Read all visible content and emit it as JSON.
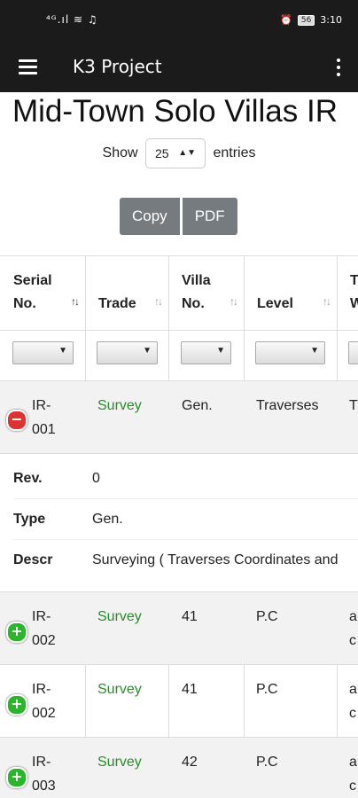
{
  "statusbar": {
    "signal": "⁴ᴳ.ıl ≋ ♫",
    "alarm": "⏰",
    "battery": "56",
    "time": "3:10"
  },
  "appbar": {
    "title": "K3 Project"
  },
  "page": {
    "title": "Mid-Town Solo Villas IR"
  },
  "length_menu": {
    "show_label": "Show",
    "selected": "25",
    "entries_label": "entries"
  },
  "buttons": {
    "copy": "Copy",
    "pdf": "PDF"
  },
  "columns": {
    "serial": {
      "line1": "Serial",
      "line2": "No."
    },
    "trade": "Trade",
    "villa": {
      "line1": "Villa",
      "line2": "No."
    },
    "level": "Level",
    "type_partial": {
      "line1": "T",
      "line2": "W"
    }
  },
  "rows": [
    {
      "serial1": "IR-",
      "serial2": "001",
      "trade": "Survey",
      "villa": "Gen.",
      "level": "Traverses",
      "extra1": "T",
      "extra2": ""
    },
    {
      "serial1": "IR-",
      "serial2": "002",
      "trade": "Survey",
      "villa": "41",
      "level": "P.C",
      "extra1": "a",
      "extra2": "c"
    },
    {
      "serial1": "IR-",
      "serial2": "002",
      "trade": "Survey",
      "villa": "41",
      "level": "P.C",
      "extra1": "a",
      "extra2": "c"
    },
    {
      "serial1": "IR-",
      "serial2": "003",
      "trade": "Survey",
      "villa": "42",
      "level": "P.C",
      "extra1": "a",
      "extra2": "c"
    }
  ],
  "detail": {
    "rev_label": "Rev.",
    "rev_value": "0",
    "type_label": "Type",
    "type_value": "Gen.",
    "descr_label": "Descr",
    "descr_value": "Surveying ( Traverses Coordinates and"
  },
  "icons": {
    "menu": "hamburger-icon",
    "more": "more-vert-icon",
    "expand": "plus-icon",
    "collapse": "minus-icon"
  }
}
